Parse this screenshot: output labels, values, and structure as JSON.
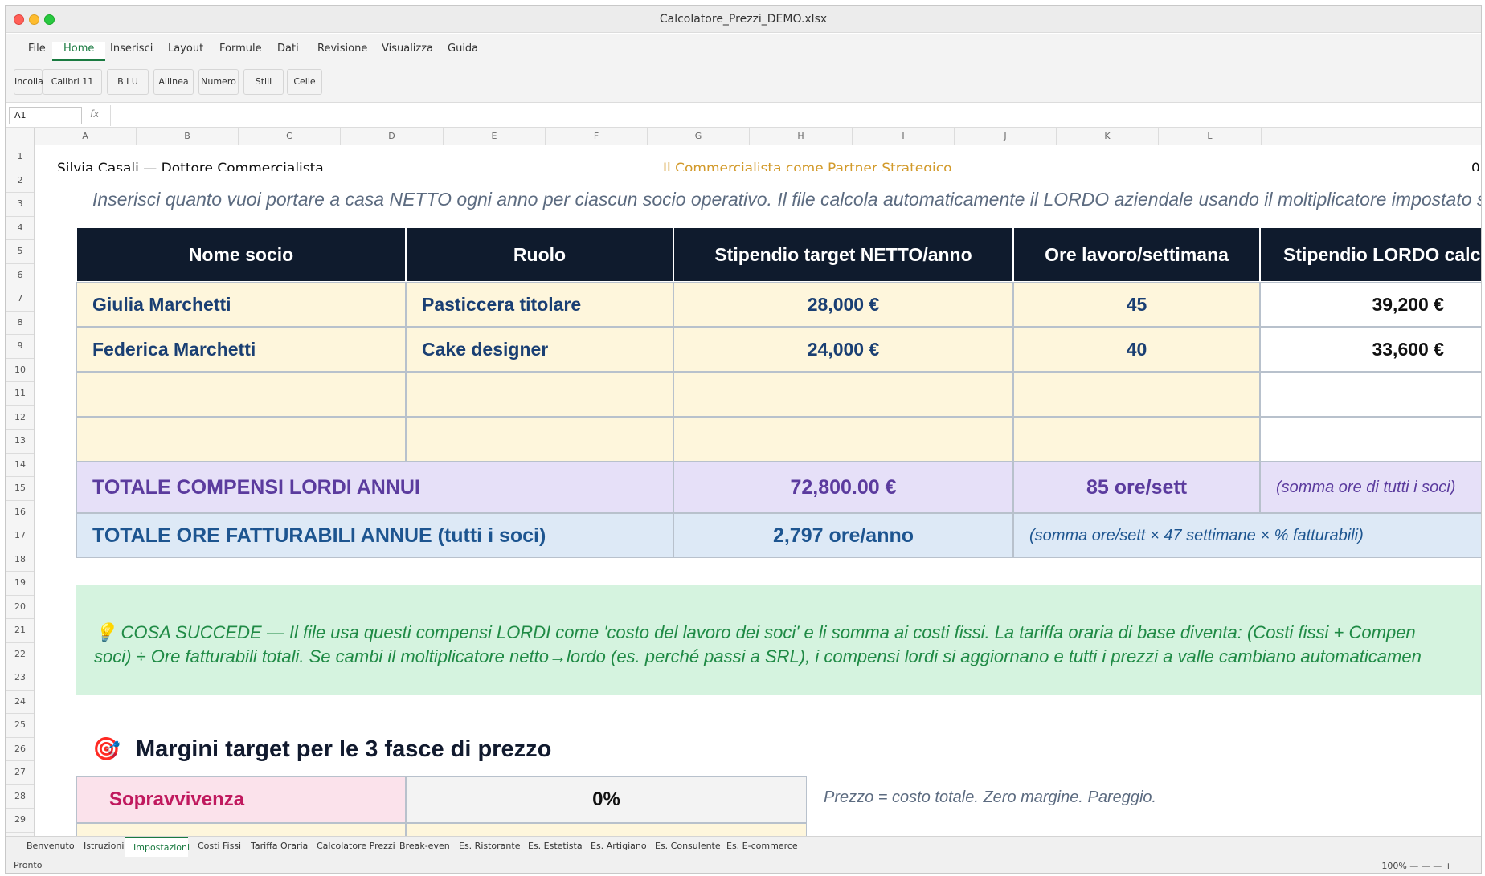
{
  "window": {
    "title": "Calcolatore_Prezzi_DEMO.xlsx"
  },
  "ribbon": {
    "tabs": [
      "File",
      "Home",
      "Inserisci",
      "Layout",
      "Formule",
      "Dati",
      "Revisione",
      "Visualizza",
      "Guida"
    ],
    "active_tab": "Home",
    "tools": [
      "Incolla",
      "Calibri 11",
      "B I U",
      "Allinea",
      "Numero",
      "Stili",
      "Celle"
    ]
  },
  "formula_bar": {
    "cell_ref": "A1",
    "fx": "fx"
  },
  "columns": [
    "A",
    "B",
    "C",
    "D",
    "E",
    "F",
    "G",
    "H",
    "I",
    "J",
    "K",
    "L"
  ],
  "rows": [
    "1",
    "2",
    "3",
    "4",
    "5",
    "6",
    "7",
    "8",
    "9",
    "10",
    "11",
    "12",
    "13",
    "14",
    "15",
    "16",
    "17",
    "18",
    "19",
    "20",
    "21",
    "22",
    "23",
    "24",
    "25",
    "26",
    "27",
    "28",
    "29"
  ],
  "sheet": {
    "header_left": "Silvia Casali — Dottore Commercialista",
    "header_center": "Il Commercialista come Partner Strategico",
    "header_right": "0",
    "intro": "Inserisci quanto vuoi portare a casa NETTO ogni anno per ciascun socio operativo. Il file calcola automaticamente il LORDO aziendale usando il moltiplicatore impostato s",
    "table": {
      "headers": [
        "Nome socio",
        "Ruolo",
        "Stipendio target NETTO/anno",
        "Ore lavoro/settimana",
        "Stipendio LORDO calco"
      ],
      "rows": [
        {
          "name": "Giulia Marchetti",
          "role": "Pasticcera titolare",
          "net": "28,000 €",
          "hours": "45",
          "gross": "39,200 €"
        },
        {
          "name": "Federica Marchetti",
          "role": "Cake designer",
          "net": "24,000 €",
          "hours": "40",
          "gross": "33,600 €"
        },
        {
          "name": "",
          "role": "",
          "net": "",
          "hours": "",
          "gross": ""
        },
        {
          "name": "",
          "role": "",
          "net": "",
          "hours": "",
          "gross": ""
        }
      ],
      "total_gross_label": "TOTALE COMPENSI LORDI ANNUI",
      "total_gross_value": "72,800.00 €",
      "total_hours_value": "85  ore/sett",
      "total_hours_note": "(somma ore di tutti i soci)",
      "billable_label": "TOTALE ORE FATTURABILI ANNUE (tutti i soci)",
      "billable_value": "2,797  ore/anno",
      "billable_note": "(somma ore/sett × 47 settimane × % fatturabili)"
    },
    "note_line1": "💡  COSA SUCCEDE — Il file usa questi compensi LORDI come 'costo del lavoro dei soci' e li somma ai costi fissi. La tariffa oraria di base diventa: (Costi fissi + Compen",
    "note_line2": "soci) ÷ Ore fatturabili totali. Se cambi il moltiplicatore netto→lordo (es. perché passi a SRL), i compensi lordi si aggiornano e tutti i prezzi a valle cambiano automaticamen",
    "margins_icon": "🎯",
    "margins_title": "Margini target per le 3 fasce di prezzo",
    "margins": [
      {
        "label": "Sopravvivenza",
        "value": "0%",
        "note": "Prezzo = costo totale. Zero margine. Pareggio."
      }
    ]
  },
  "sheet_tabs": [
    "Benvenuto",
    "Istruzioni",
    "Impostazioni",
    "Costi Fissi",
    "Tariffa Oraria",
    "Calcolatore Prezzi",
    "Break-even",
    "Es. Ristorante",
    "Es. Estetista",
    "Es. Artigiano",
    "Es. Consulente",
    "Es. E-commerce"
  ],
  "active_sheet": "Impostazioni",
  "status": {
    "text": "Pronto",
    "zoom": "100% — — — +"
  }
}
